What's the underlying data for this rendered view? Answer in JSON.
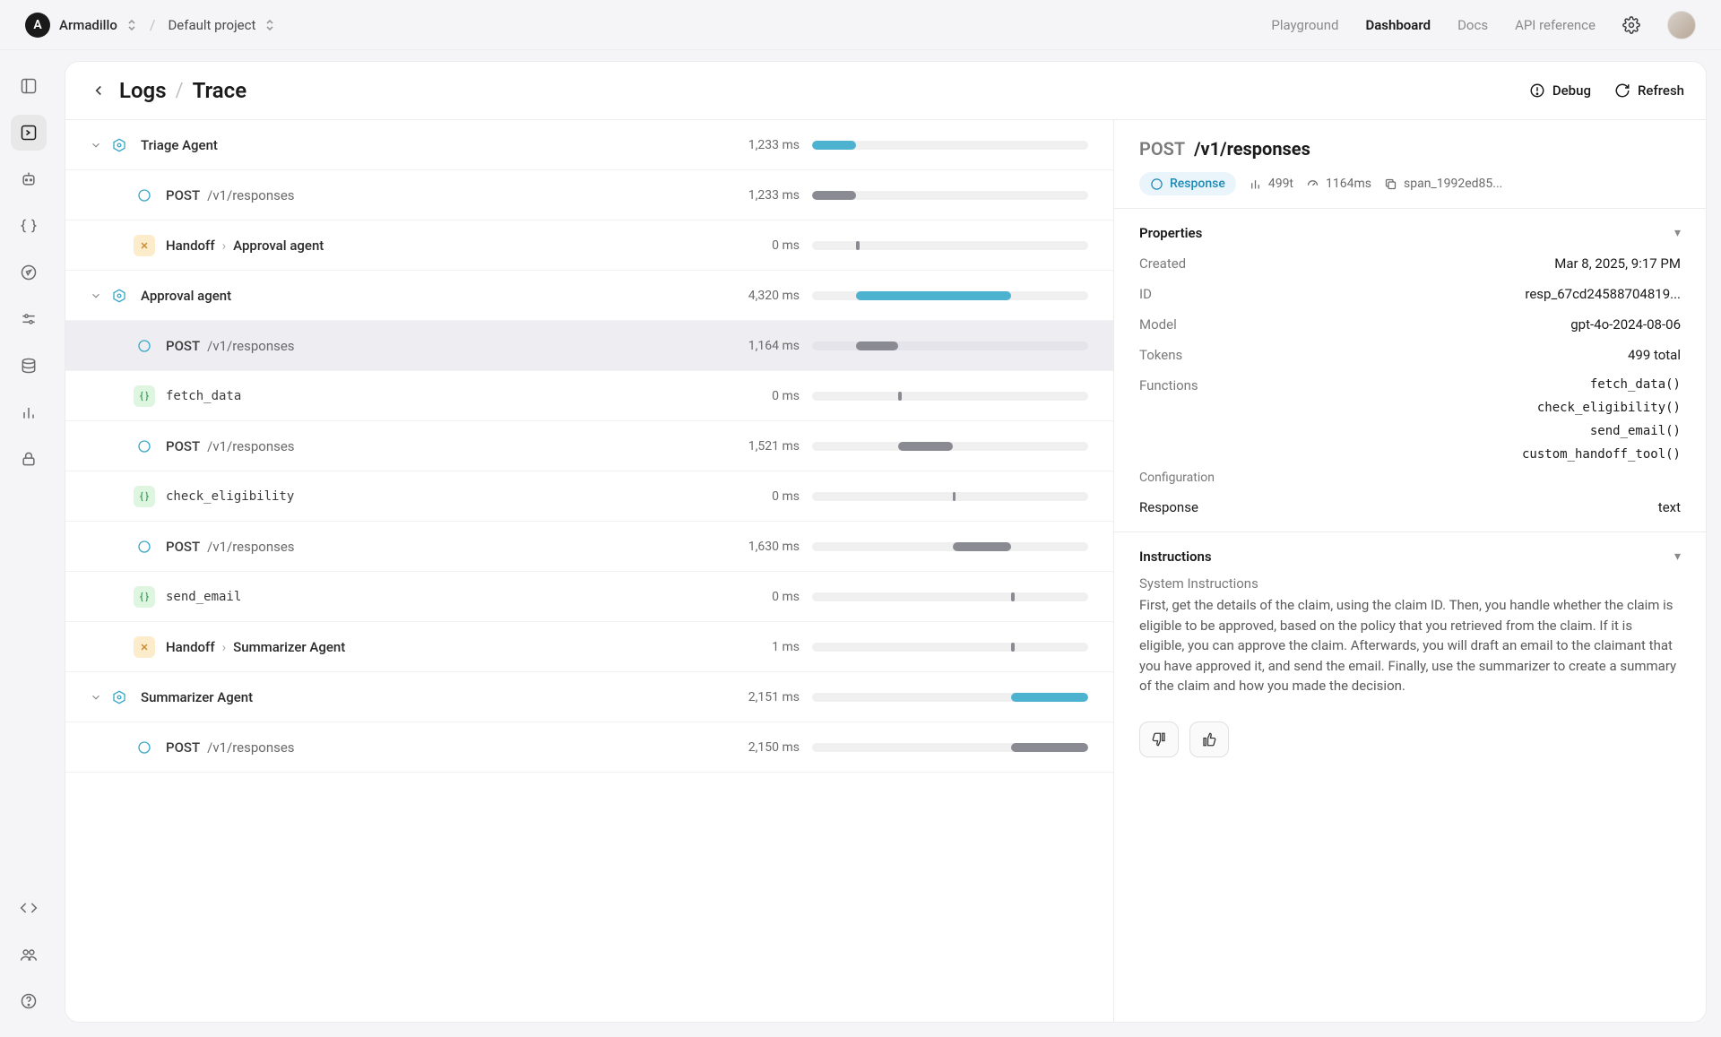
{
  "topbar": {
    "org_initial": "A",
    "org_name": "Armadillo",
    "project_name": "Default project",
    "nav": {
      "playground": "Playground",
      "dashboard": "Dashboard",
      "docs": "Docs",
      "api_ref": "API reference"
    }
  },
  "crumbs": {
    "parent": "Logs",
    "current": "Trace"
  },
  "actions": {
    "debug": "Debug",
    "refresh": "Refresh"
  },
  "timeline_total_ms": 7700,
  "spans": [
    {
      "depth": 0,
      "icon": "agent",
      "expandable": true,
      "label_kind": "name",
      "name": "Triage Agent",
      "dur": "1,233 ms",
      "start": 0,
      "len": 1233,
      "color": "blue"
    },
    {
      "depth": 1,
      "icon": "post",
      "label_kind": "req",
      "method": "POST",
      "path": "/v1/responses",
      "dur": "1,233 ms",
      "start": 0,
      "len": 1233,
      "color": "gray"
    },
    {
      "depth": 1,
      "icon": "handoff",
      "label_kind": "handoff",
      "from": "Handoff",
      "to": "Approval agent",
      "dur": "0 ms",
      "start": 1233,
      "len": 40,
      "color": "gray"
    },
    {
      "depth": 0,
      "icon": "agent",
      "expandable": true,
      "label_kind": "name",
      "name": "Approval agent",
      "dur": "4,320 ms",
      "start": 1233,
      "len": 4320,
      "color": "blue"
    },
    {
      "depth": 1,
      "icon": "post",
      "selected": true,
      "label_kind": "req",
      "method": "POST",
      "path": "/v1/responses",
      "dur": "1,164 ms",
      "start": 1233,
      "len": 1164,
      "color": "gray"
    },
    {
      "depth": 1,
      "icon": "fn",
      "label_kind": "mono",
      "name": "fetch_data",
      "dur": "0 ms",
      "start": 2397,
      "len": 40,
      "color": "gray"
    },
    {
      "depth": 1,
      "icon": "post",
      "label_kind": "req",
      "method": "POST",
      "path": "/v1/responses",
      "dur": "1,521 ms",
      "start": 2397,
      "len": 1521,
      "color": "gray"
    },
    {
      "depth": 1,
      "icon": "fn",
      "label_kind": "mono",
      "name": "check_eligibility",
      "dur": "0 ms",
      "start": 3918,
      "len": 40,
      "color": "gray"
    },
    {
      "depth": 1,
      "icon": "post",
      "label_kind": "req",
      "method": "POST",
      "path": "/v1/responses",
      "dur": "1,630 ms",
      "start": 3918,
      "len": 1630,
      "color": "gray"
    },
    {
      "depth": 1,
      "icon": "fn",
      "label_kind": "mono",
      "name": "send_email",
      "dur": "0 ms",
      "start": 5548,
      "len": 40,
      "color": "gray"
    },
    {
      "depth": 1,
      "icon": "handoff",
      "label_kind": "handoff",
      "from": "Handoff",
      "to": "Summarizer Agent",
      "dur": "1 ms",
      "start": 5548,
      "len": 40,
      "color": "gray"
    },
    {
      "depth": 0,
      "icon": "agent",
      "expandable": true,
      "label_kind": "name",
      "name": "Summarizer Agent",
      "dur": "2,151 ms",
      "start": 5550,
      "len": 2151,
      "color": "blue"
    },
    {
      "depth": 1,
      "icon": "post",
      "label_kind": "req",
      "method": "POST",
      "path": "/v1/responses",
      "dur": "2,150 ms",
      "start": 5550,
      "len": 2150,
      "color": "gray"
    }
  ],
  "detail": {
    "method": "POST",
    "path": "/v1/responses",
    "meta": {
      "response_label": "Response",
      "tokens": "499t",
      "latency": "1164ms",
      "span_id": "span_1992ed85..."
    },
    "sections": {
      "properties": "Properties",
      "instructions": "Instructions"
    },
    "props": {
      "created_k": "Created",
      "created_v": "Mar 8, 2025, 9:17 PM",
      "id_k": "ID",
      "id_v": "resp_67cd24588704819...",
      "model_k": "Model",
      "model_v": "gpt-4o-2024-08-06",
      "tokens_k": "Tokens",
      "tokens_v": "499 total",
      "functions_k": "Functions",
      "functions": [
        "fetch_data()",
        "check_eligibility()",
        "send_email()",
        "custom_handoff_tool()"
      ],
      "config_k": "Configuration",
      "response_k": "Response",
      "response_v": "text"
    },
    "instructions": {
      "label": "System Instructions",
      "body": "First, get the details of the claim, using the claim ID. Then, you handle whether the claim is eligible to be approved, based on the policy that you retrieved from the claim. If it is eligible, you can approve the claim. Afterwards, you will draft an email to the claimant that you have approved it, and send the email. Finally, use the summarizer to create a summary of the claim and how you made the decision."
    }
  }
}
